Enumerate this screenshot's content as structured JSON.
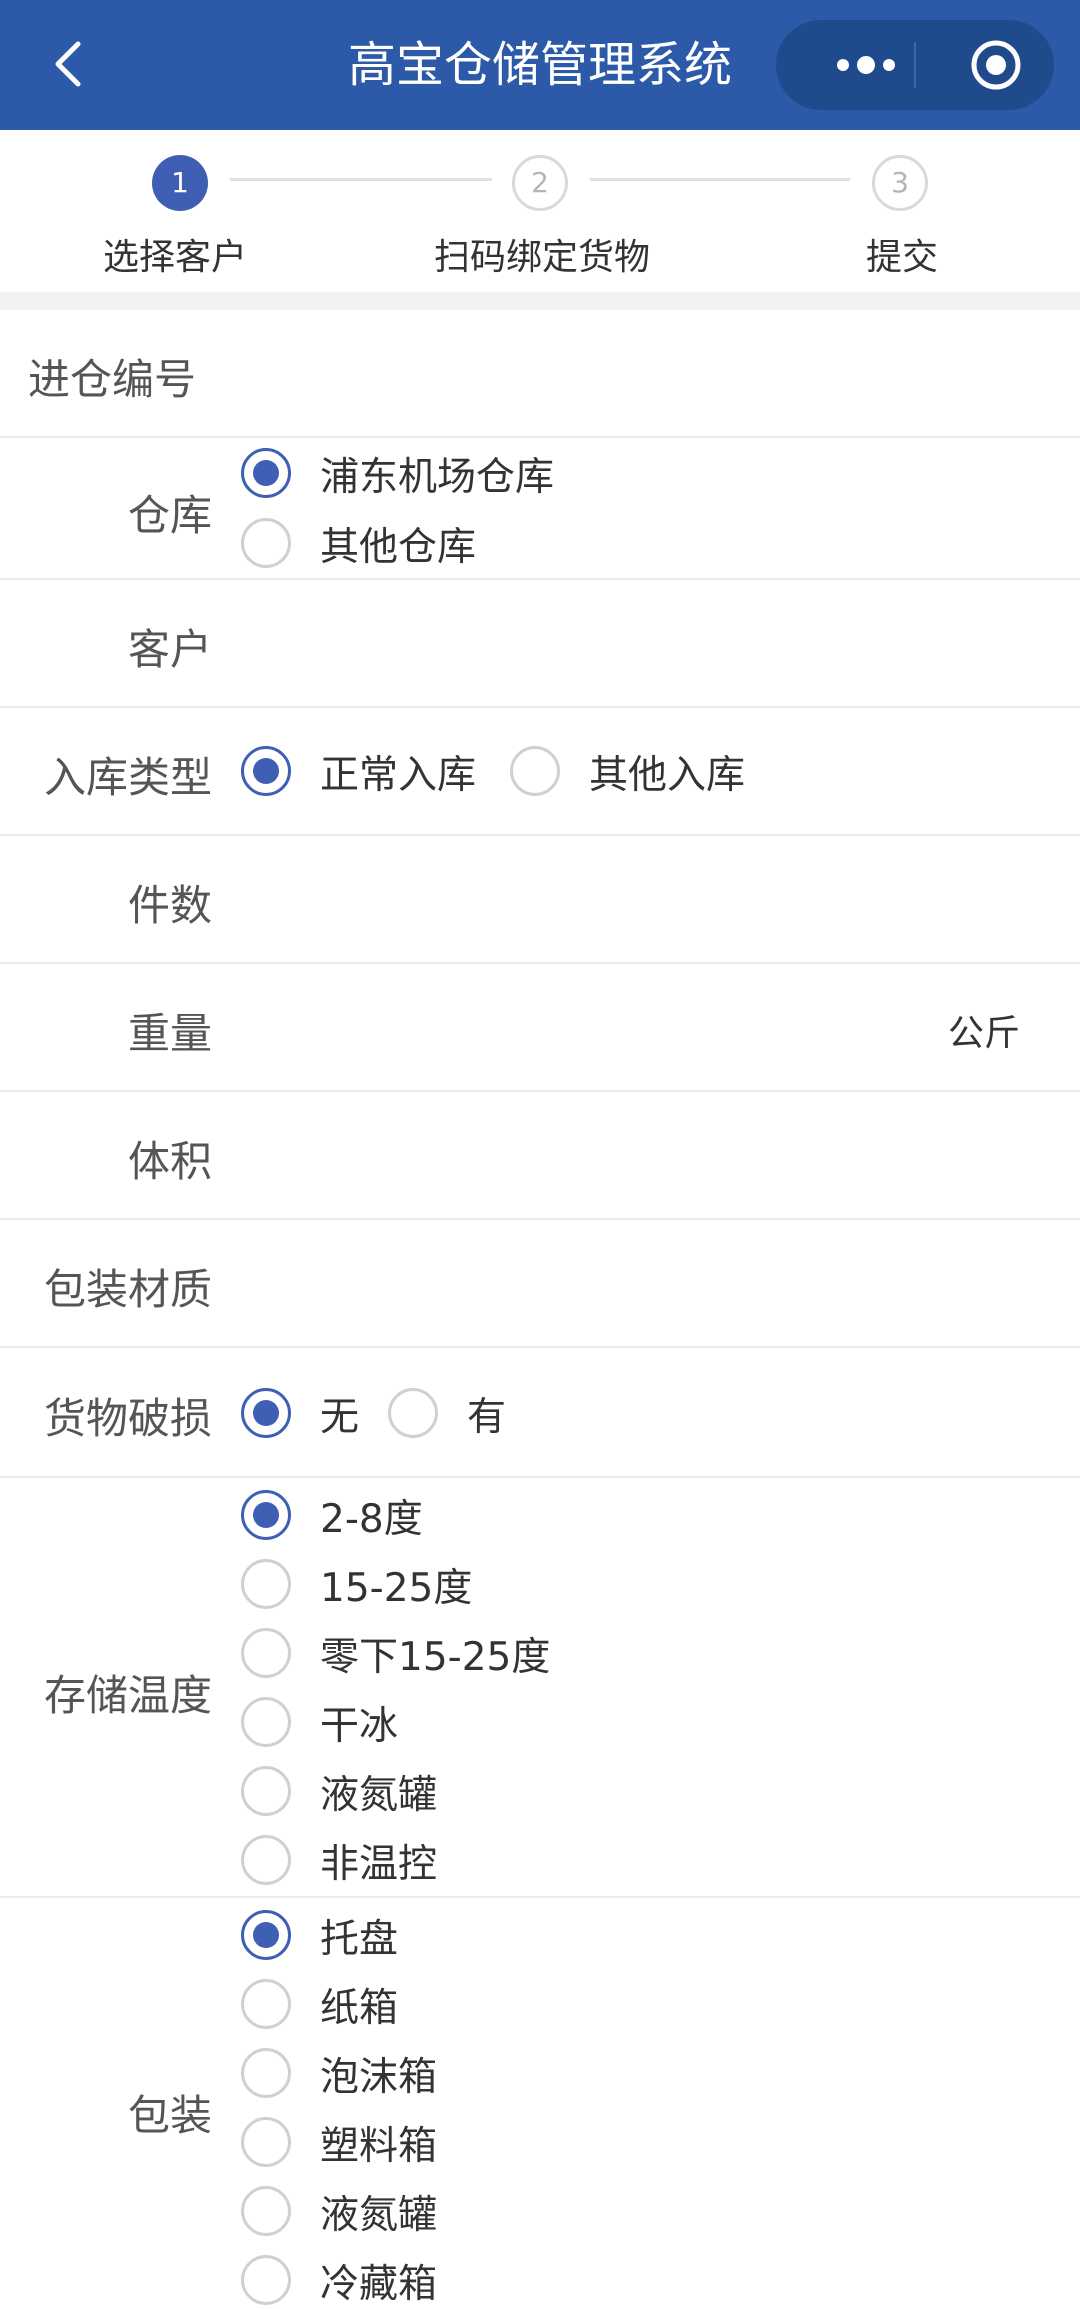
{
  "header": {
    "title": "高宝仓储管理系统"
  },
  "steps": [
    {
      "num": "1",
      "label": "选择客户"
    },
    {
      "num": "2",
      "label": "扫码绑定货物"
    },
    {
      "num": "3",
      "label": "提交"
    }
  ],
  "form": {
    "entry_no_label": "进仓编号",
    "warehouse": {
      "label": "仓库",
      "options": [
        "浦东机场仓库",
        "其他仓库"
      ],
      "selected": "浦东机场仓库"
    },
    "customer_label": "客户",
    "inbound_type": {
      "label": "入库类型",
      "options": [
        "正常入库",
        "其他入库"
      ],
      "selected": "正常入库"
    },
    "pieces_label": "件数",
    "weight": {
      "label": "重量",
      "unit": "公斤"
    },
    "volume_label": "体积",
    "packing_material_label": "包装材质",
    "damage": {
      "label": "货物破损",
      "options": [
        "无",
        "有"
      ],
      "selected": "无"
    },
    "storage_temp": {
      "label": "存储温度",
      "options": [
        "2-8度",
        "15-25度",
        "零下15-25度",
        "干冰",
        "液氮罐",
        "非温控"
      ],
      "selected": "2-8度"
    },
    "packaging": {
      "label": "包装",
      "options": [
        "托盘",
        "纸箱",
        "泡沫箱",
        "塑料箱",
        "液氮罐",
        "冷藏箱"
      ],
      "selected": "托盘"
    }
  },
  "colors": {
    "header_bg": "#2c5aa8",
    "accent": "#3f5fb5"
  }
}
